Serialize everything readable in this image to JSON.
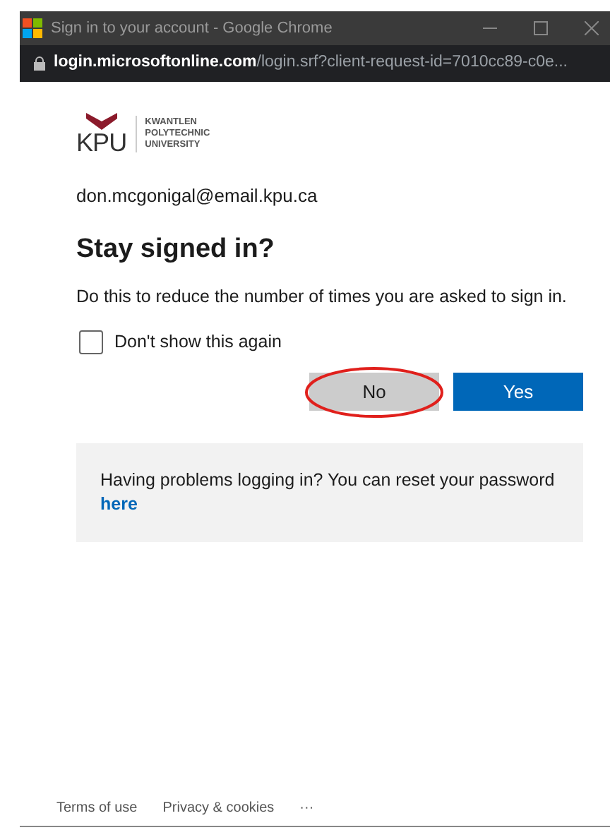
{
  "window": {
    "title": "Sign in to your account - Google Chrome"
  },
  "address_bar": {
    "domain": "login.microsoftonline.com",
    "path": "/login.srf?client-request-id=7010cc89-c0e..."
  },
  "logo": {
    "short": "KPU",
    "name_lines": [
      "KWANTLEN",
      "POLYTECHNIC",
      "UNIVERSITY"
    ]
  },
  "account": "don.mcgonigal@email.kpu.ca",
  "heading": "Stay signed in?",
  "description": "Do this to reduce the number of times you are asked to sign in.",
  "checkbox": {
    "label": "Don't show this again",
    "checked": false
  },
  "buttons": [
    {
      "label": "No",
      "kind": "secondary",
      "circled": true
    },
    {
      "label": "Yes",
      "kind": "primary",
      "circled": false
    }
  ],
  "help": {
    "text": "Having problems logging in? You can reset your password",
    "link": "here"
  },
  "footer": [
    "Terms of use",
    "Privacy & cookies",
    "···"
  ]
}
